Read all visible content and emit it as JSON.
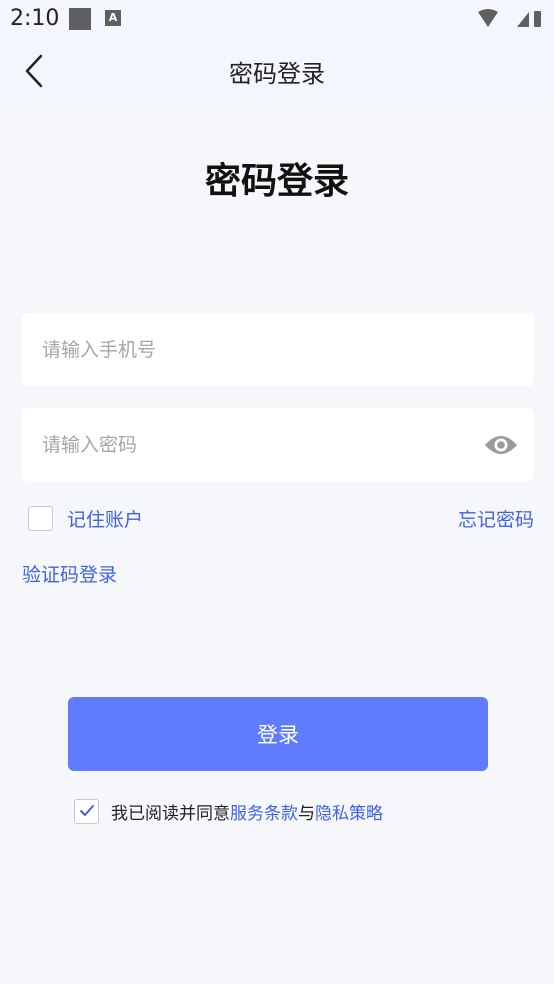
{
  "status_bar": {
    "time": "2:10",
    "notification_letter": "A"
  },
  "nav": {
    "title": "密码登录"
  },
  "heading": "密码登录",
  "form": {
    "phone_placeholder": "请输入手机号",
    "phone_value": "",
    "password_placeholder": "请输入密码",
    "password_value": "",
    "remember_label": "记住账户",
    "remember_checked": false,
    "forgot_label": "忘记密码",
    "sms_login_label": "验证码登录",
    "login_label": "登录"
  },
  "agreement": {
    "checked": true,
    "prefix": "我已阅读并同意",
    "terms_label": "服务条款",
    "conjunction": "与",
    "privacy_label": "隐私策略"
  },
  "colors": {
    "accent": "#3f62e8",
    "button": "#5e7cfd",
    "background": "#f5f7fb",
    "header": "#f3f6fd"
  }
}
